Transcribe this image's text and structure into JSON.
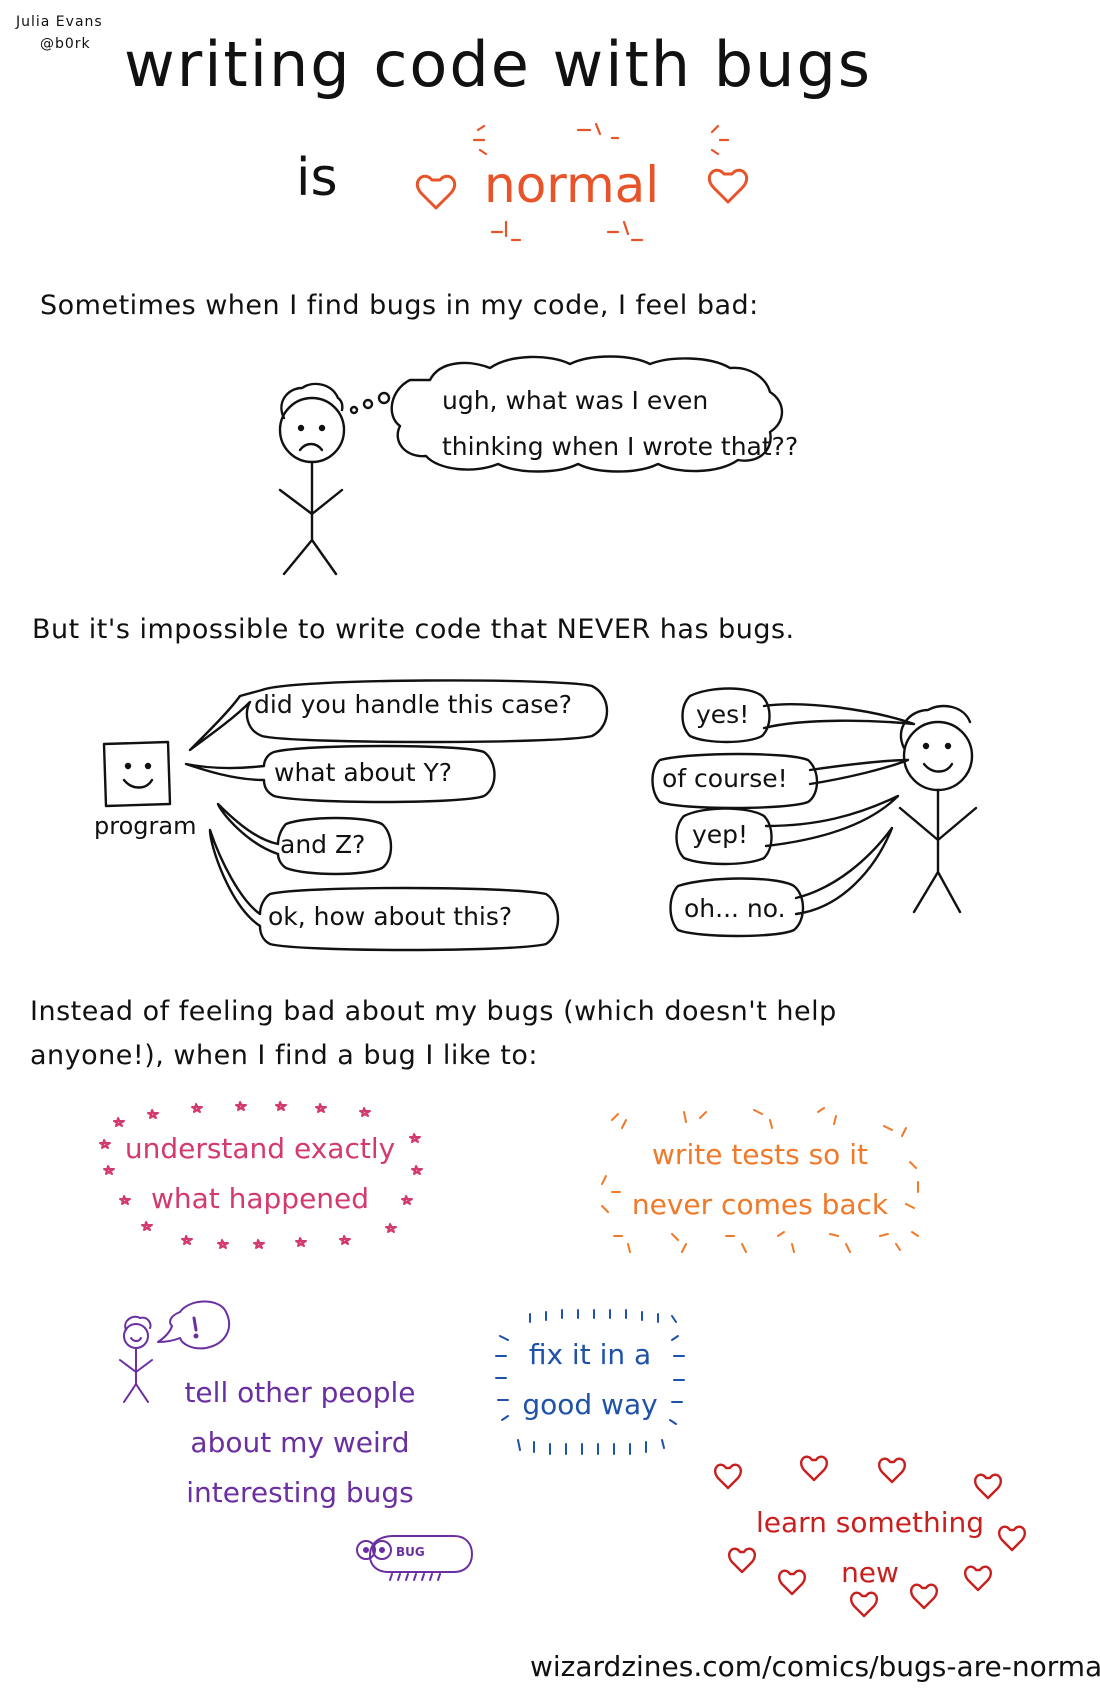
{
  "author": {
    "name": "Julia Evans",
    "handle": "@b0rk"
  },
  "title": {
    "line1": "writing code with bugs",
    "is": "is",
    "highlight": "normal"
  },
  "section1": {
    "intro": "Sometimes when I find bugs in my code, I feel bad:",
    "thought": [
      "ugh, what was I even",
      "thinking when I wrote that??"
    ]
  },
  "section2": {
    "intro": "But it's impossible to write code that NEVER has bugs.",
    "program_label": "program",
    "program_questions": [
      "did you handle this case?",
      "what about Y?",
      "and Z?",
      "ok, how about this?"
    ],
    "person_answers": [
      "yes!",
      "of course!",
      "yep!",
      "oh... no."
    ]
  },
  "section3": {
    "intro_line1": "Instead of feeling bad about my bugs (which doesn't help",
    "intro_line2": "anyone!), when I find a bug I like to:",
    "items": {
      "understand": [
        "understand exactly",
        "what happened"
      ],
      "tests": [
        "write tests so it",
        "never comes back"
      ],
      "tell": [
        "tell other people",
        "about my weird",
        "interesting bugs"
      ],
      "fix": [
        "fix it in a",
        "good way"
      ],
      "learn": [
        "learn something",
        "new"
      ]
    },
    "bug_label": "BUG"
  },
  "footer": {
    "url": "wizardzines.com/comics/bugs-are-normal"
  },
  "colors": {
    "ink": "#111111",
    "normal": "#e8542a",
    "understand": "#d33a6e",
    "tests": "#f07a2a",
    "tell": "#6a2fa0",
    "fix": "#1f52a8",
    "learn": "#c8201e"
  }
}
